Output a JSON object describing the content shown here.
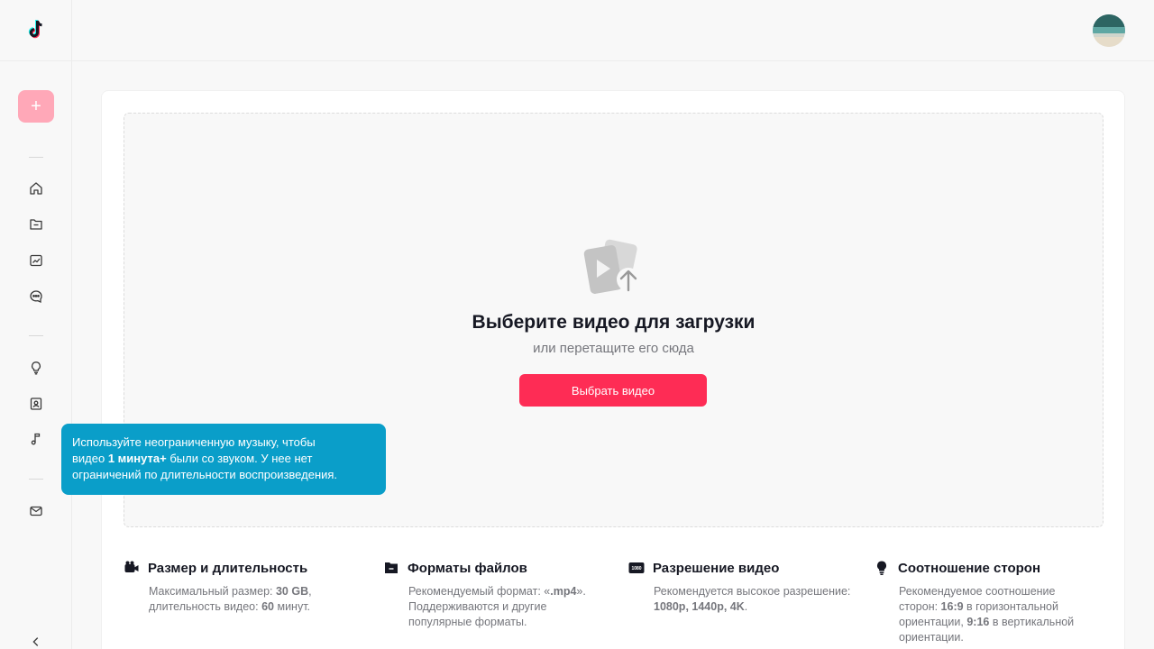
{
  "sidebar": {
    "add_label": "+",
    "icons": [
      "home-icon",
      "folder-icon",
      "analytics-icon",
      "comments-icon",
      "lightbulb-icon",
      "library-icon",
      "music-icon",
      "mail-icon"
    ]
  },
  "upload": {
    "title": "Выберите видео для загрузки",
    "subtitle": "или перетащите его сюда",
    "button": "Выбрать видео"
  },
  "info": [
    {
      "icon": "camera-icon",
      "title": "Размер и длительность",
      "line1": "Максимальный размер: ",
      "bold1": "30 GB",
      "line2": ",",
      "line3": "длительность видео: ",
      "bold2": "60",
      "line4": " минут."
    },
    {
      "icon": "file-icon",
      "title": "Форматы файлов",
      "line1": "Рекомендуемый формат: «",
      "bold1": ".mp4",
      "line2": "».",
      "line3": "Поддерживаются и другие",
      "line4": "популярные форматы."
    },
    {
      "icon": "resolution-icon",
      "title": "Разрешение видео",
      "line1": "Рекомендуется высокое разрешение:",
      "bold1": "1080p, 1440p, 4K",
      "line2": "."
    },
    {
      "icon": "lightbulb-icon",
      "title": "Соотношение сторон",
      "line1": "Рекомендуемое соотношение",
      "line2": "сторон: ",
      "bold1": "16:9",
      "line3": " в горизонтальной",
      "line4": "ориентации, ",
      "bold2": "9:16",
      "line5": " в вертикальной",
      "line6": "ориентации."
    }
  ],
  "tooltip": {
    "part1": "Используйте неограниченную музыку, чтобы",
    "part2": "видео ",
    "bold": "1 минута+",
    "part3": " были со звуком. У нее нет",
    "part4": "ограничений по длительности воспроизведения."
  },
  "resolution_badge": "1080",
  "colors": {
    "accent": "#fe2c55",
    "add_button": "#ffa8b8",
    "tooltip": "#0a9ec9"
  }
}
